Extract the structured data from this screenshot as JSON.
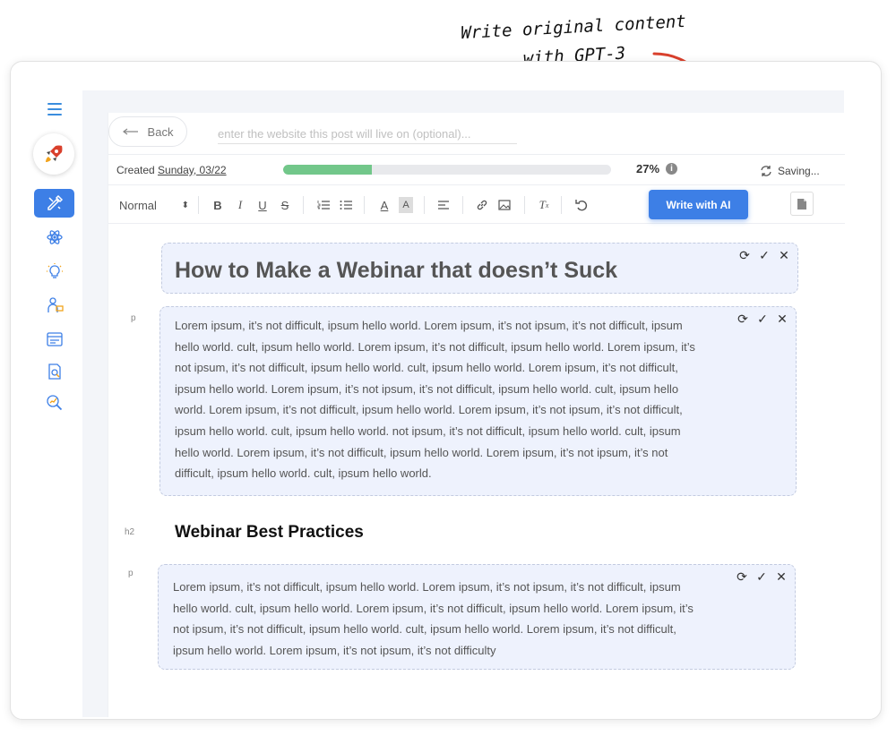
{
  "annotation": {
    "line1": "Write original content",
    "line2": "with GPT-3"
  },
  "sidebar": {
    "logo_icon": "rocket-icon",
    "items": [
      {
        "icon": "pen-ruler-icon",
        "active": true
      },
      {
        "icon": "atom-icon",
        "active": false
      },
      {
        "icon": "lightbulb-icon",
        "active": false
      },
      {
        "icon": "person-board-icon",
        "active": false
      },
      {
        "icon": "browser-card-icon",
        "active": false
      },
      {
        "icon": "document-search-icon",
        "active": false
      },
      {
        "icon": "magnify-chart-icon",
        "active": false
      }
    ]
  },
  "topbar": {
    "back_label": "Back",
    "url_placeholder": "enter the website this post will live on (optional)..."
  },
  "status": {
    "created_prefix": "Created",
    "created_date": "Sunday, 03/22",
    "progress_fraction": 0.27,
    "progress_label": "27%",
    "saving_label": "Saving..."
  },
  "toolbar": {
    "format_value": "Normal",
    "ai_button_label": "Write with AI",
    "colors": {
      "accent": "#3d7fe6",
      "progress": "#72c78a"
    }
  },
  "editor": {
    "title": "How to Make a Webinar that doesn’t Suck",
    "para1_tag": "p",
    "para1_lines": [
      "Lorem ipsum, it’s not difficult, ipsum hello world. Lorem ipsum, it’s not ipsum, it’s not difficult, ipsum",
      "hello world. cult, ipsum hello world. Lorem ipsum, it’s not difficult, ipsum hello world. Lorem ipsum, it’s",
      "not ipsum, it’s not difficult, ipsum hello world. cult, ipsum hello world. Lorem ipsum, it’s not difficult,",
      "ipsum hello world. Lorem ipsum, it’s not ipsum, it’s not difficult, ipsum hello world. cult, ipsum hello",
      "world. Lorem ipsum, it’s not difficult, ipsum hello world. Lorem ipsum, it’s not ipsum, it’s not difficult,",
      "ipsum hello world. cult, ipsum hello world. not ipsum, it’s not difficult, ipsum hello world. cult, ipsum",
      "hello world. Lorem ipsum, it’s not difficult, ipsum hello world. Lorem ipsum, it’s not ipsum, it’s not",
      "difficult, ipsum hello world. cult, ipsum hello world."
    ],
    "h2_tag": "h2",
    "h2_text": "Webinar Best Practices",
    "para2_tag": "p",
    "para2_lines": [
      "Lorem ipsum, it’s not difficult, ipsum hello world. Lorem ipsum, it’s not ipsum, it’s not difficult, ipsum",
      "hello world. cult, ipsum hello world. Lorem ipsum, it’s not difficult, ipsum hello world. Lorem ipsum, it’s",
      "not ipsum, it’s not difficult, ipsum hello world. cult, ipsum hello world. Lorem ipsum, it’s not difficult,",
      "ipsum hello world. Lorem ipsum, it’s not ipsum, it’s not difficulty"
    ]
  }
}
